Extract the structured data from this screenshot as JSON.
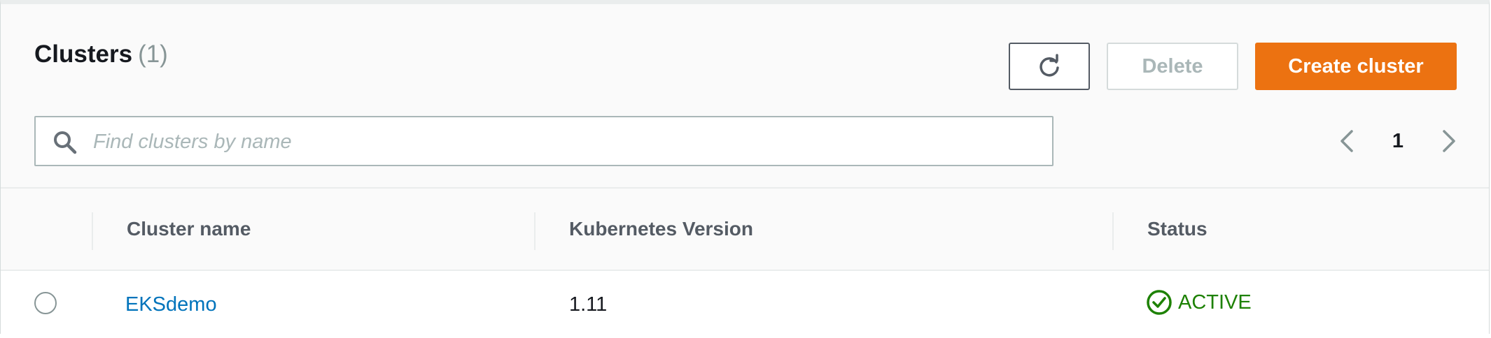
{
  "header": {
    "title": "Clusters",
    "count": "(1)"
  },
  "toolbar": {
    "refresh_icon": "refresh-icon",
    "delete_label": "Delete",
    "create_label": "Create cluster"
  },
  "search": {
    "placeholder": "Find clusters by name",
    "value": "",
    "icon": "search-icon"
  },
  "pagination": {
    "current_page": "1",
    "prev_icon": "chevron-left-icon",
    "next_icon": "chevron-right-icon"
  },
  "table": {
    "columns": [
      "Cluster name",
      "Kubernetes Version",
      "Status"
    ],
    "rows": [
      {
        "name": "EKSdemo",
        "version": "1.11",
        "status": "ACTIVE",
        "status_icon": "check-circle-icon"
      }
    ]
  },
  "colors": {
    "primary_button": "#ec7211",
    "link": "#0073bb",
    "status_active": "#1d8102"
  }
}
